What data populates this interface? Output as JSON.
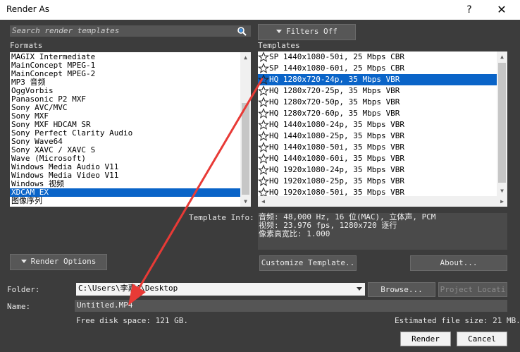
{
  "window": {
    "title": "Render As",
    "help_glyph": "?",
    "close_glyph": "✕"
  },
  "search": {
    "placeholder": "Search render templates"
  },
  "filters_button": {
    "label": "Filters Off"
  },
  "formats": {
    "label": "Formats",
    "items": [
      {
        "label": "MAGIX Intermediate",
        "selected": false
      },
      {
        "label": "MainConcept MPEG-1",
        "selected": false
      },
      {
        "label": "MainConcept MPEG-2",
        "selected": false
      },
      {
        "label": "MP3 音频",
        "selected": false
      },
      {
        "label": "OggVorbis",
        "selected": false
      },
      {
        "label": "Panasonic P2 MXF",
        "selected": false
      },
      {
        "label": "Sony AVC/MVC",
        "selected": false
      },
      {
        "label": "Sony MXF",
        "selected": false
      },
      {
        "label": "Sony MXF HDCAM SR",
        "selected": false
      },
      {
        "label": "Sony Perfect Clarity Audio",
        "selected": false
      },
      {
        "label": "Sony Wave64",
        "selected": false
      },
      {
        "label": "Sony XAVC / XAVC S",
        "selected": false
      },
      {
        "label": "Wave (Microsoft)",
        "selected": false
      },
      {
        "label": "Windows Media Audio V11",
        "selected": false
      },
      {
        "label": "Windows Media Video V11",
        "selected": false
      },
      {
        "label": "Windows 视频",
        "selected": false
      },
      {
        "label": "XDCAM EX",
        "selected": true
      },
      {
        "label": "图像序列",
        "selected": false
      }
    ]
  },
  "templates": {
    "label": "Templates",
    "items": [
      {
        "label": "SP 1440x1080-50i, 25 Mbps CBR",
        "selected": false
      },
      {
        "label": "SP 1440x1080-60i, 25 Mbps CBR",
        "selected": false
      },
      {
        "label": "HQ 1280x720-24p, 35 Mbps VBR",
        "selected": true
      },
      {
        "label": "HQ 1280x720-25p, 35 Mbps VBR",
        "selected": false
      },
      {
        "label": "HQ 1280x720-50p, 35 Mbps VBR",
        "selected": false
      },
      {
        "label": "HQ 1280x720-60p, 35 Mbps VBR",
        "selected": false
      },
      {
        "label": "HQ 1440x1080-24p, 35 Mbps VBR",
        "selected": false
      },
      {
        "label": "HQ 1440x1080-25p, 35 Mbps VBR",
        "selected": false
      },
      {
        "label": "HQ 1440x1080-50i, 35 Mbps VBR",
        "selected": false
      },
      {
        "label": "HQ 1440x1080-60i, 35 Mbps VBR",
        "selected": false
      },
      {
        "label": "HQ 1920x1080-24p, 35 Mbps VBR",
        "selected": false
      },
      {
        "label": "HQ 1920x1080-25p, 35 Mbps VBR",
        "selected": false
      },
      {
        "label": "HQ 1920x1080-50i, 35 Mbps VBR",
        "selected": false
      }
    ]
  },
  "template_info": {
    "label": "Template Info:",
    "lines": [
      "音频: 48,000 Hz, 16 位(MAC), 立体声, PCM",
      "视频: 23.976 fps, 1280x720 逐行",
      "像素高宽比: 1.000"
    ]
  },
  "buttons": {
    "render_options": "Render Options",
    "customize_template": "Customize Template..",
    "about": "About...",
    "browse": "Browse...",
    "project_location": "Project Locati",
    "render": "Render",
    "cancel": "Cancel"
  },
  "folder": {
    "label": "Folder:",
    "value": "C:\\Users\\李嘉4\\Desktop"
  },
  "name": {
    "label": "Name:",
    "value": "Untitled.MP4"
  },
  "status": {
    "free_disk_space": "Free disk space: 121 GB.",
    "estimated_file_size": "Estimated file size: 21 MB."
  },
  "colors": {
    "background": "#3c3c3c",
    "selection": "#0a64c8",
    "annotation_arrow": "#e83a36"
  },
  "icons": {
    "search": "magnifier-icon",
    "template_item": "star-outline-icon"
  }
}
